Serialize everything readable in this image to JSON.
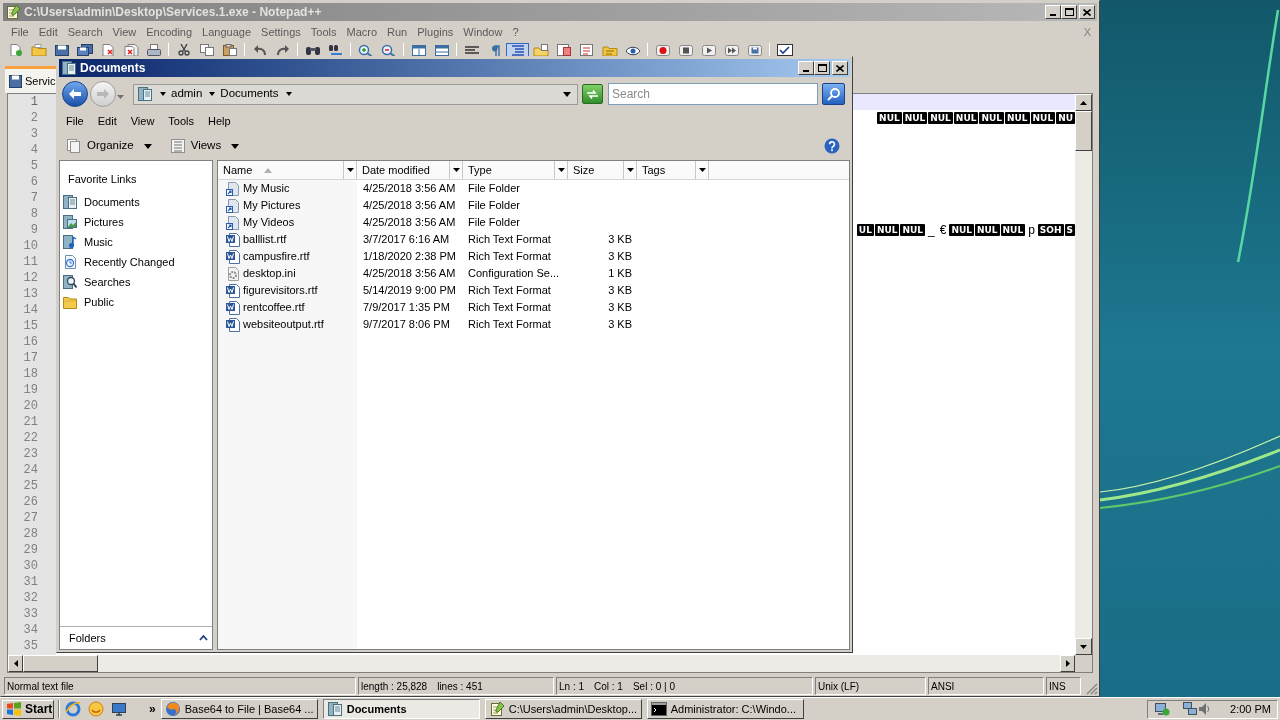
{
  "notepad": {
    "title": "C:\\Users\\admin\\Desktop\\Services.1.exe - Notepad++",
    "menu": [
      "File",
      "Edit",
      "Search",
      "View",
      "Encoding",
      "Language",
      "Settings",
      "Tools",
      "Macro",
      "Run",
      "Plugins",
      "Window",
      "?"
    ],
    "close_document": "X",
    "toolbar": [
      [
        {
          "kind": "new",
          "pressed": false
        },
        {
          "kind": "open",
          "pressed": false
        },
        {
          "kind": "save",
          "pressed": false
        },
        {
          "kind": "saveall",
          "pressed": false
        },
        {
          "kind": "close",
          "pressed": false
        },
        {
          "kind": "closeall",
          "pressed": false
        },
        {
          "kind": "print",
          "pressed": false
        }
      ],
      [
        {
          "kind": "cut",
          "pressed": false
        },
        {
          "kind": "copy",
          "pressed": false
        },
        {
          "kind": "paste",
          "pressed": false
        }
      ],
      [
        {
          "kind": "undo",
          "pressed": false
        },
        {
          "kind": "redo",
          "pressed": false
        }
      ],
      [
        {
          "kind": "find",
          "pressed": false
        },
        {
          "kind": "replace",
          "pressed": false
        }
      ],
      [
        {
          "kind": "zoomin",
          "pressed": false
        },
        {
          "kind": "zoomout",
          "pressed": false
        }
      ],
      [
        {
          "kind": "syncv",
          "pressed": false
        },
        {
          "kind": "synch",
          "pressed": false
        }
      ],
      [
        {
          "kind": "wrap",
          "pressed": false
        },
        {
          "kind": "allchars",
          "pressed": false
        },
        {
          "kind": "indent",
          "pressed": true
        },
        {
          "kind": "udl",
          "pressed": false
        },
        {
          "kind": "docmap",
          "pressed": false
        },
        {
          "kind": "funclist",
          "pressed": false
        },
        {
          "kind": "workspace",
          "pressed": false
        },
        {
          "kind": "monitor",
          "pressed": false
        }
      ],
      [
        {
          "kind": "record",
          "pressed": false
        },
        {
          "kind": "stop",
          "pressed": false
        },
        {
          "kind": "play",
          "pressed": false
        },
        {
          "kind": "playmulti",
          "pressed": false
        },
        {
          "kind": "savemacro",
          "pressed": false
        }
      ],
      [
        {
          "kind": "spell",
          "pressed": false
        }
      ]
    ],
    "tab": {
      "label": "Servic",
      "selected": true
    },
    "lines": [
      {
        "number": "1",
        "current": true
      },
      {
        "number": "2",
        "current": false,
        "tokens": [
          {
            "kind": "control",
            "text": "NUL"
          },
          {
            "kind": "control",
            "text": "NUL"
          },
          {
            "kind": "control",
            "text": "NUL"
          },
          {
            "kind": "control",
            "text": "NUL"
          },
          {
            "kind": "control",
            "text": "NUL"
          },
          {
            "kind": "control",
            "text": "NUL"
          },
          {
            "kind": "control",
            "text": "NUL"
          },
          {
            "kind": "control",
            "text": "NU"
          }
        ]
      },
      {
        "number": "3",
        "current": false
      },
      {
        "number": "4",
        "current": false
      },
      {
        "number": "5",
        "current": false
      },
      {
        "number": "6",
        "current": false
      },
      {
        "number": "7",
        "current": false
      },
      {
        "number": "8",
        "current": false
      },
      {
        "number": "9",
        "current": false,
        "tokens": [
          {
            "kind": "control",
            "text": "UL"
          },
          {
            "kind": "control",
            "text": "NUL"
          },
          {
            "kind": "control",
            "text": "NUL"
          },
          {
            "kind": "plain",
            "text": "_"
          },
          {
            "kind": "plain",
            "text": "€"
          },
          {
            "kind": "control",
            "text": "NUL"
          },
          {
            "kind": "control",
            "text": "NUL"
          },
          {
            "kind": "control",
            "text": "NUL"
          },
          {
            "kind": "plain",
            "text": "p"
          },
          {
            "kind": "control",
            "text": "SOH"
          },
          {
            "kind": "control",
            "text": "S"
          }
        ]
      },
      {
        "number": "10",
        "current": false
      },
      {
        "number": "11",
        "current": false
      },
      {
        "number": "12",
        "current": false
      },
      {
        "number": "13",
        "current": false
      },
      {
        "number": "14",
        "current": false
      },
      {
        "number": "15",
        "current": false
      },
      {
        "number": "16",
        "current": false
      },
      {
        "number": "17",
        "current": false
      },
      {
        "number": "18",
        "current": false
      },
      {
        "number": "19",
        "current": false
      },
      {
        "number": "20",
        "current": false
      },
      {
        "number": "21",
        "current": false
      },
      {
        "number": "22",
        "current": false
      },
      {
        "number": "23",
        "current": false
      },
      {
        "number": "24",
        "current": false
      },
      {
        "number": "25",
        "current": false
      },
      {
        "number": "26",
        "current": false
      },
      {
        "number": "27",
        "current": false
      },
      {
        "number": "28",
        "current": false
      },
      {
        "number": "29",
        "current": false
      },
      {
        "number": "30",
        "current": false
      },
      {
        "number": "31",
        "current": false
      },
      {
        "number": "32",
        "current": false
      },
      {
        "number": "33",
        "current": false
      },
      {
        "number": "34",
        "current": false
      },
      {
        "number": "35",
        "current": false
      }
    ],
    "status_bar": [
      {
        "texts": [
          "Normal text file"
        ]
      },
      {
        "texts": [
          "length : 25,828",
          "lines : 451"
        ]
      },
      {
        "texts": [
          "Ln : 1",
          "Col : 1",
          "Sel : 0 | 0"
        ]
      },
      {
        "texts": [
          "Unix (LF)"
        ]
      },
      {
        "texts": [
          "ANSI"
        ]
      },
      {
        "texts": [
          "INS"
        ]
      }
    ]
  },
  "explorer": {
    "title": "Documents",
    "nav_buttons": [
      {
        "kind": "back",
        "disabled": false
      },
      {
        "kind": "forward",
        "disabled": true
      }
    ],
    "breadcrumb": [
      "admin",
      "Documents"
    ],
    "search": {
      "placeholder": "Search"
    },
    "menu": [
      "File",
      "Edit",
      "View",
      "Tools",
      "Help"
    ],
    "toolbar": [
      {
        "kind": "organize",
        "label": "Organize"
      },
      {
        "kind": "views",
        "label": "Views"
      }
    ],
    "favorites_heading": "Favorite Links",
    "favorites": [
      {
        "kind": "documents",
        "label": "Documents"
      },
      {
        "kind": "pictures",
        "label": "Pictures"
      },
      {
        "kind": "music",
        "label": "Music"
      },
      {
        "kind": "recent",
        "label": "Recently Changed"
      },
      {
        "kind": "searches",
        "label": "Searches"
      },
      {
        "kind": "public",
        "label": "Public"
      }
    ],
    "folders_pane": {
      "label": "Folders",
      "expanded": false
    },
    "columns": [
      {
        "label": "Name",
        "sorted": true
      },
      {
        "label": "Date modified",
        "sorted": false
      },
      {
        "label": "Type",
        "sorted": false
      },
      {
        "label": "Size",
        "sorted": false
      },
      {
        "label": "Tags",
        "sorted": false
      }
    ],
    "rows": [
      {
        "kind": "folder",
        "name": "My Music",
        "date_modified": "4/25/2018 3:56 AM",
        "type": "File Folder"
      },
      {
        "kind": "folder",
        "name": "My Pictures",
        "date_modified": "4/25/2018 3:56 AM",
        "type": "File Folder"
      },
      {
        "kind": "folder",
        "name": "My Videos",
        "date_modified": "4/25/2018 3:56 AM",
        "type": "File Folder"
      },
      {
        "kind": "document",
        "name": "balllist.rtf",
        "date_modified": "3/7/2017 6:16 AM",
        "type": "Rich Text Format",
        "size": "3 KB"
      },
      {
        "kind": "document",
        "name": "campusfire.rtf",
        "date_modified": "1/18/2020 2:38 PM",
        "type": "Rich Text Format",
        "size": "3 KB"
      },
      {
        "kind": "settings",
        "name": "desktop.ini",
        "date_modified": "4/25/2018 3:56 AM",
        "type": "Configuration Se...",
        "size": "1 KB"
      },
      {
        "kind": "document",
        "name": "figurevisitors.rtf",
        "date_modified": "5/14/2019 9:00 PM",
        "type": "Rich Text Format",
        "size": "3 KB"
      },
      {
        "kind": "document",
        "name": "rentcoffee.rtf",
        "date_modified": "7/9/2017 1:35 PM",
        "type": "Rich Text Format",
        "size": "3 KB"
      },
      {
        "kind": "document",
        "name": "websiteoutput.rtf",
        "date_modified": "9/7/2017 8:06 PM",
        "type": "Rich Text Format",
        "size": "3 KB"
      }
    ]
  },
  "taskbar": {
    "start": "Start",
    "overflow": "»",
    "tasks": [
      {
        "kind": "browser",
        "label": "Base64 to File | Base64 ...",
        "selected": false
      },
      {
        "kind": "explorer",
        "label": "Documents",
        "selected": true
      },
      {
        "kind": "notepad",
        "label": "C:\\Users\\admin\\Desktop...",
        "selected": false
      },
      {
        "kind": "console",
        "label": "Administrator: C:\\Windo...",
        "selected": false
      }
    ],
    "clock": "2:00 PM"
  }
}
